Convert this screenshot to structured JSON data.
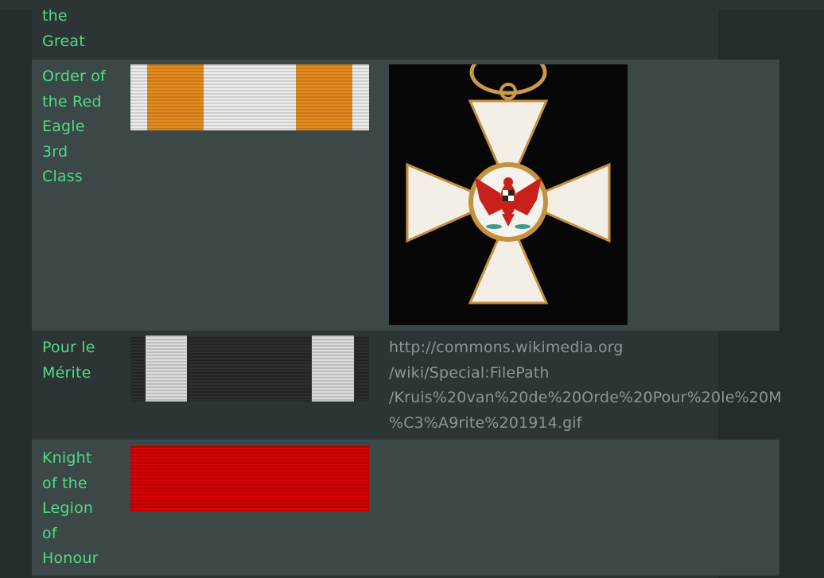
{
  "rows": [
    {
      "name_lines": [
        "the",
        "Great"
      ]
    },
    {
      "name_lines": [
        "Order of",
        "the Red",
        "Eagle",
        "3rd",
        "Class"
      ],
      "ribbon": "orange-white"
    },
    {
      "name_lines": [
        "Pour le",
        "Mérite"
      ],
      "ribbon": "black-white",
      "url_lines": [
        "http://commons.wikimedia.org",
        "/wiki/Special:FilePath",
        "/Kruis%20van%20de%20Orde%20Pour%20le%20M",
        "%C3%A9rite%201914.gif"
      ]
    },
    {
      "name_lines": [
        "Knight",
        "of the",
        "Legion",
        "of",
        "Honour"
      ],
      "ribbon": "red"
    }
  ],
  "colors": {
    "link_green": "#4fdc86",
    "url_gray": "#8f9595",
    "ribbon_orange": "#e58b1f",
    "ribbon_red": "#e00000"
  },
  "icons": {
    "medal": "order-of-the-red-eagle-cross-icon"
  }
}
